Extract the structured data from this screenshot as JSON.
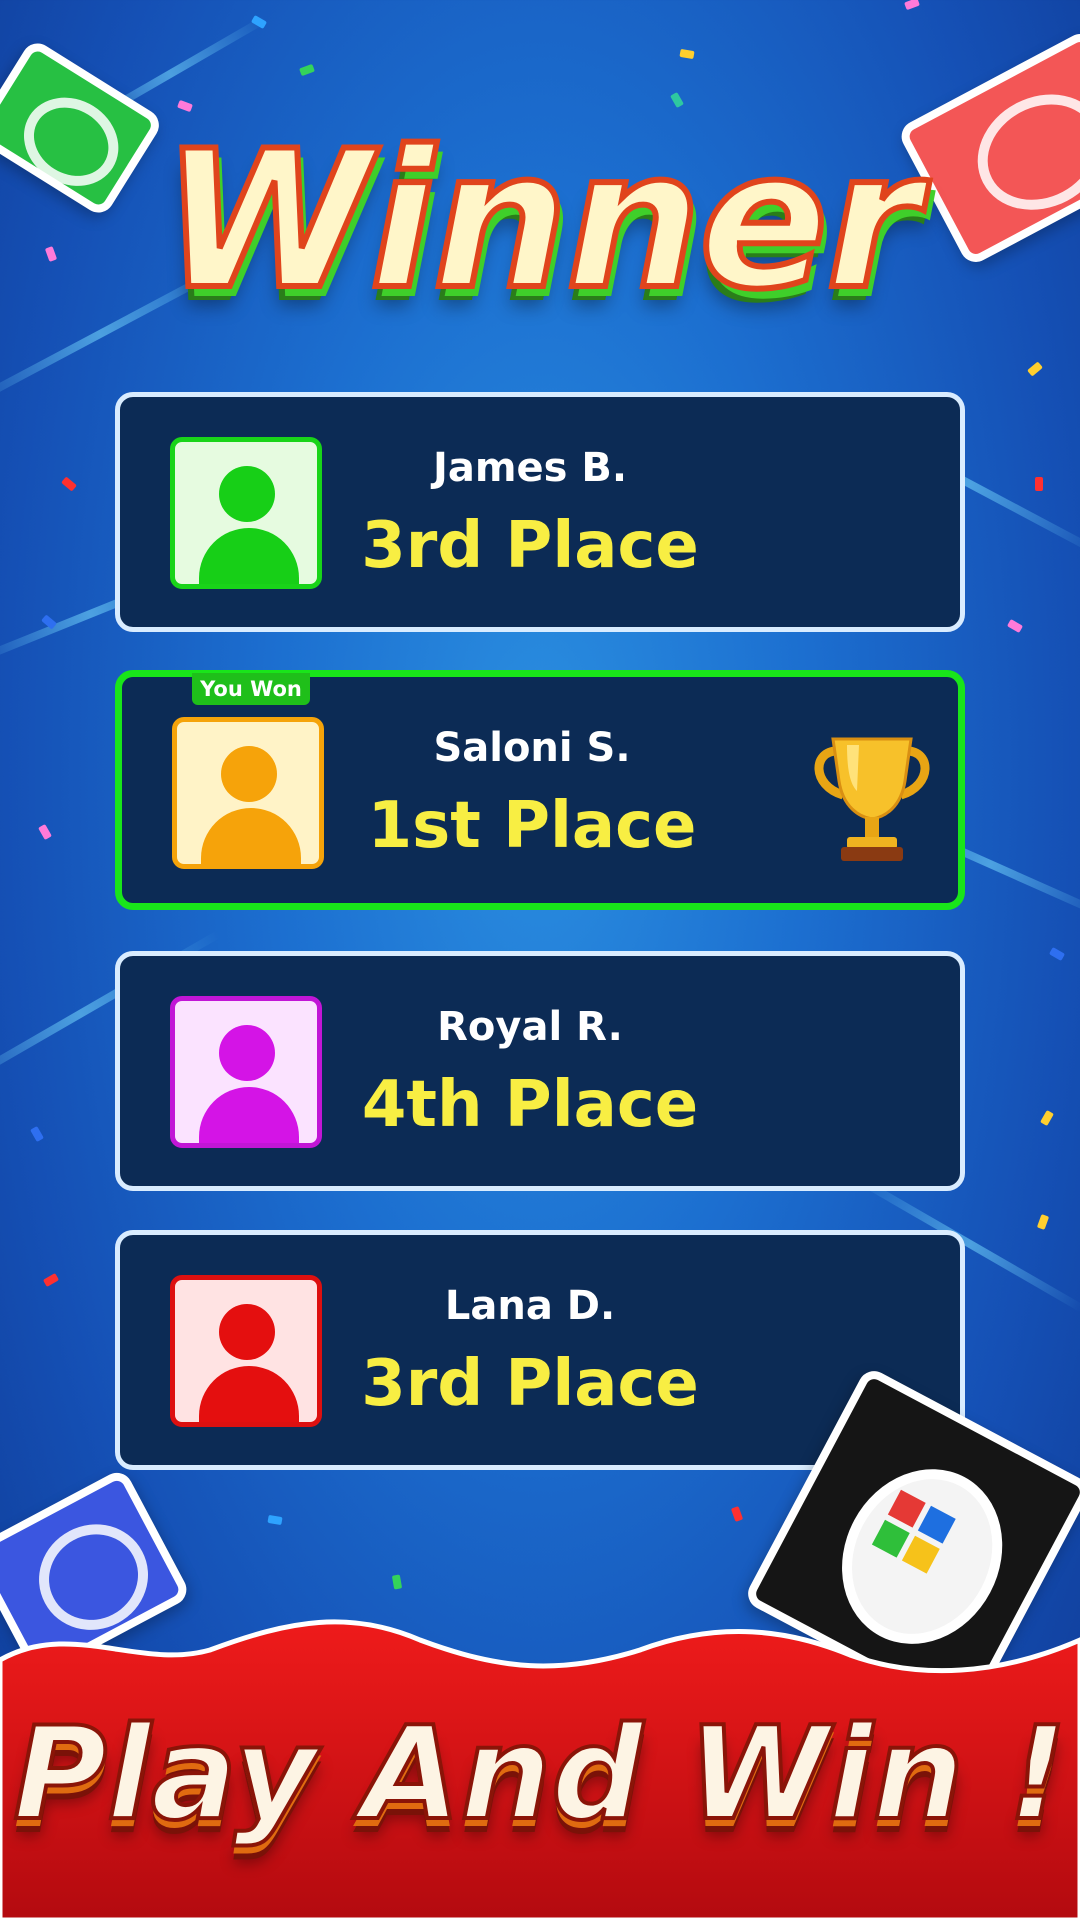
{
  "title": "Winner",
  "players": [
    {
      "name": "James B.",
      "place": "3rd Place",
      "avatar_color": "#17cf17",
      "avatar_bg": "#e6fbe0",
      "avatar_border": "#19d419"
    },
    {
      "name": "Saloni S.",
      "place": "1st Place",
      "avatar_color": "#f6a30a",
      "avatar_bg": "#fff3c7",
      "avatar_border": "#f5a30a",
      "badge": "You Won",
      "has_trophy": true
    },
    {
      "name": "Royal R.",
      "place": "4th Place",
      "avatar_color": "#d414e6",
      "avatar_bg": "#fbe3ff",
      "avatar_border": "#c116d6"
    },
    {
      "name": "Lana D.",
      "place": "3rd Place",
      "avatar_color": "#e40f0f",
      "avatar_bg": "#ffe3e3",
      "avatar_border": "#dd1010"
    }
  ],
  "cta": {
    "label": "Play And Win !"
  },
  "colors": {
    "panel_bg": "#0c2b55",
    "panel_border": "#d9ecff",
    "winner_border": "#19e51a",
    "place_text": "#f8ee43",
    "name_text": "#ffffff",
    "footer_red": "#e0121a"
  },
  "icons": {
    "trophy": "trophy-icon",
    "avatar": "person-icon"
  }
}
